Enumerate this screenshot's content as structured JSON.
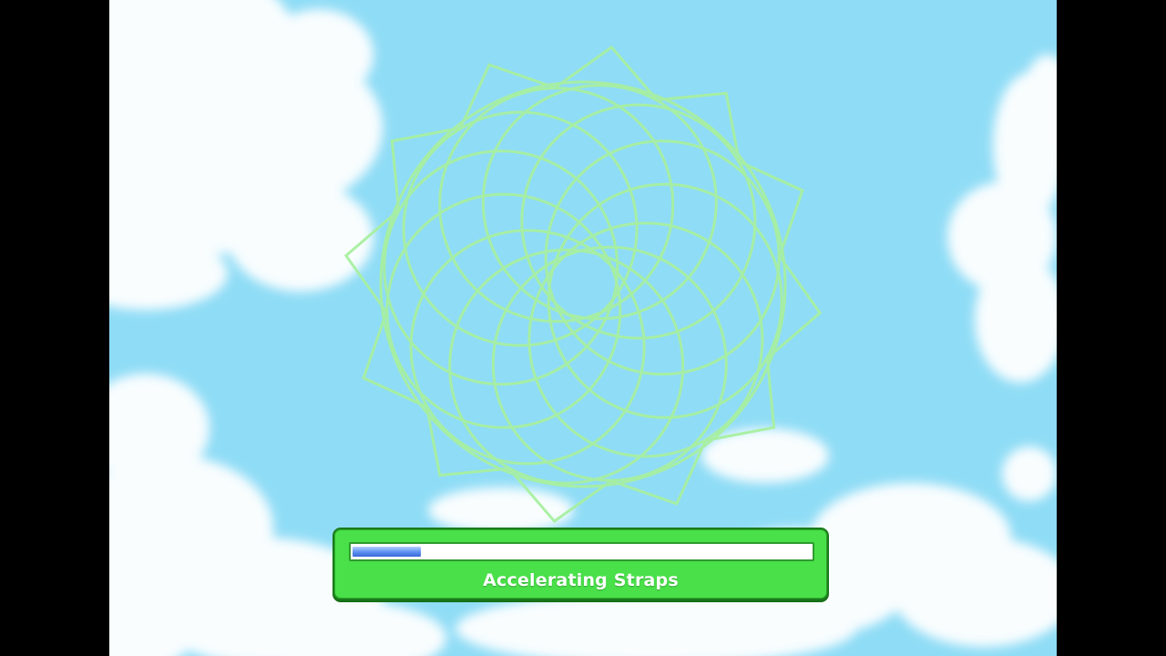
{
  "screen": {
    "background_color": "#000000",
    "sky_color": "#8fdcf6",
    "cloud_color": "#ffffff"
  },
  "emblem": {
    "icon": "spirograph-loading-emblem",
    "stroke_color": "#a8f0a0",
    "petal_count": 12
  },
  "loading": {
    "label": "Accelerating Straps",
    "progress_percent": 15,
    "panel_color": "#49e049",
    "bar_fill_color": "#5a8ef0"
  }
}
